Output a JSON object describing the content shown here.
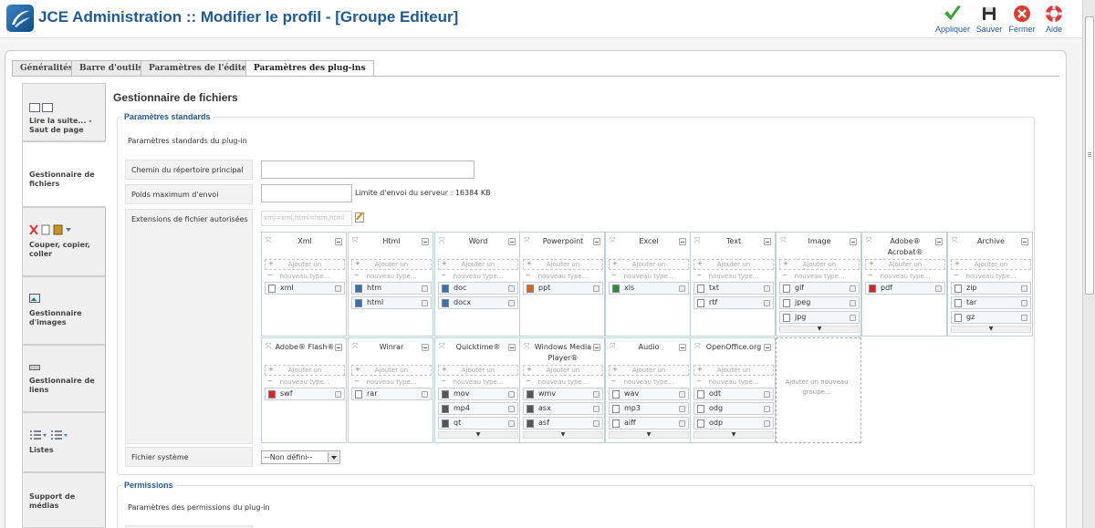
{
  "header": {
    "title": "JCE Administration :: Modifier le profil - [Groupe Editeur]",
    "buttons": {
      "apply": "Appliquer",
      "save": "Sauver",
      "close": "Fermer",
      "help": "Aide"
    }
  },
  "tabs": [
    "Généralités",
    "Barre d'outils",
    "Paramètres de l'éditeur",
    "Paramètres des plug-ins"
  ],
  "sidebar": [
    {
      "label": "Lire la suite... - Saut de page",
      "icon": "page-break-icon"
    },
    {
      "label": "Gestionnaire de fichiers",
      "icon": ""
    },
    {
      "label": "Couper, copier, coller",
      "icon": "cut-copy-paste-icon"
    },
    {
      "label": "Gestionnaire d'images",
      "icon": "image-icon"
    },
    {
      "label": "Gestionnaire de liens",
      "icon": "link-icon"
    },
    {
      "label": "Listes",
      "icon": "list-icon"
    },
    {
      "label": "Support de médias",
      "icon": ""
    }
  ],
  "plugin_title": "Gestionnaire de fichiers",
  "standard": {
    "legend": "Paramètres standards",
    "description": "Paramètres standards du plug-in",
    "root_dir_label": "Chemin du répertoire principal",
    "root_dir_value": "",
    "max_upload_label": "Poids maximum d'envoi",
    "max_upload_value": "",
    "server_limit": "Limite d'envoi du serveur : 16384 KB",
    "extensions_label": "Extensions de fichier autorisées",
    "extensions_value": "xml=xml;html=htm,html",
    "filesystem_label": "Fichier système",
    "filesystem_value": "--Non défini--"
  },
  "groups_ui": {
    "add_one": "Ajouter un",
    "new_type": "nouveau type...",
    "add_group": "Ajouter un nouveau groupe..."
  },
  "groups": [
    {
      "name": "Xml",
      "items": [
        "xml"
      ]
    },
    {
      "name": "Html",
      "items": [
        "htm",
        "html"
      ]
    },
    {
      "name": "Word",
      "items": [
        "doc",
        "docx"
      ]
    },
    {
      "name": "Powerpoint",
      "items": [
        "ppt"
      ]
    },
    {
      "name": "Excel",
      "items": [
        "xls"
      ]
    },
    {
      "name": "Text",
      "items": [
        "txt",
        "rtf"
      ]
    },
    {
      "name": "Image",
      "items": [
        "gif",
        "jpeg",
        "jpg"
      ]
    },
    {
      "name": "Adobe® Acrobat®",
      "items": [
        "pdf"
      ]
    },
    {
      "name": "Archive",
      "items": [
        "zip",
        "tar",
        "gz"
      ]
    },
    {
      "name": "Adobe® Flash®",
      "items": [
        "swf"
      ]
    },
    {
      "name": "Winrar",
      "items": [
        "rar"
      ]
    },
    {
      "name": "Quicktime®",
      "items": [
        "mov",
        "mp4",
        "qt"
      ]
    },
    {
      "name": "Windows Media Player®",
      "items": [
        "wmv",
        "asx",
        "asf"
      ]
    },
    {
      "name": "Audio",
      "items": [
        "wav",
        "mp3",
        "aiff"
      ]
    },
    {
      "name": "OpenOffice.org",
      "items": [
        "odt",
        "odg",
        "odp"
      ]
    }
  ],
  "permissions": {
    "legend": "Permissions",
    "description": "Paramètres des permissions du plug-in"
  },
  "colors": {
    "title": "#1e5a98",
    "accent": "#1e5a98"
  }
}
